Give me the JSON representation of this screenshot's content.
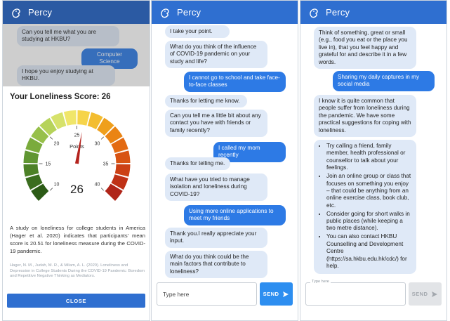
{
  "app": {
    "name": "Percy"
  },
  "panel1": {
    "chat": [
      {
        "from": "bot",
        "text": "Can you tell me what you are studying at HKBU?"
      },
      {
        "from": "user",
        "text": "Computer Science"
      },
      {
        "from": "bot",
        "text": "I hope you enjoy studying at HKBU."
      }
    ],
    "score_title": "Your Loneliness Score: 26",
    "gauge": {
      "value": 26,
      "unit_label": "Points",
      "min": 10,
      "max": 40,
      "ticks": [
        "10",
        "15",
        "20",
        "25",
        "30",
        "35",
        "40"
      ],
      "needle_color": "#b4231d"
    },
    "study_text": "A study on loneliness for college students in America (Hager et al. 2020) indicates that participants' mean score is 20.51 for loneliness measure during the COVID-19 pandemic.",
    "reference": "Hager, N. M., Judah, M. R., & Milam, A. L. (2020). Loneliness and Depression in College Students During the COVID-19 Pandemic: Boredom and Repetitive Negative Thinking as Mediators.",
    "close_label": "CLOSE"
  },
  "panel2": {
    "chat": [
      {
        "from": "bot",
        "text": "I take your point."
      },
      {
        "from": "bot",
        "text": "What do you think of the influence of COVID-19 pandemic on your study and life?"
      },
      {
        "from": "user",
        "text": "I cannot go to school and take face-to-face classes"
      },
      {
        "from": "bot",
        "text": "Thanks for letting me know."
      },
      {
        "from": "bot",
        "text": "Can you tell me a little bit about any contact you have with friends or family recently?"
      },
      {
        "from": "user",
        "text": "I called my mom recently"
      },
      {
        "from": "bot",
        "text": "Thanks for telling me."
      },
      {
        "from": "bot",
        "text": "What have you tried to manage isolation and loneliness during COVID-19?"
      },
      {
        "from": "user",
        "text": "Using more online applications to meet my friends"
      },
      {
        "from": "bot",
        "text": "Thank you.I really appreciate your input."
      },
      {
        "from": "bot",
        "text": "What do you think could be the main factors that contribute to loneliness?"
      }
    ],
    "input_placeholder": "Type here",
    "send_label": "SEND"
  },
  "panel3": {
    "chat": [
      {
        "from": "bot",
        "text": "Think of something, great or small (e.g., food you eat or the place you live in), that you feel happy and grateful for and describe it in a few words."
      },
      {
        "from": "user",
        "text": "Sharing my daily captures in my social media"
      },
      {
        "from": "bot",
        "text": "I know it is quite common that people suffer from loneliness during the pandemic. We have some practical suggestions for coping with loneliness."
      }
    ],
    "tips": [
      "Try calling a friend, family member, health professional or counsellor to talk about your feelings.",
      "Join an online group or class that focuses on something you enjoy – that could be anything from an online exercise class, book club, etc.",
      "Consider going for short walks in public places (while keeping a two metre distance).",
      "You can also contact HKBU Counselling and Development Centre (https://sa.hkbu.edu.hk/cdc/) for help."
    ],
    "input_label": "Type here",
    "send_label": "SEND"
  },
  "colors": {
    "appbar": "#2f6fd0",
    "bot_bubble": "#dfe9f7",
    "user_bubble": "#2d7ae5",
    "send_active": "#2d8ef0"
  }
}
